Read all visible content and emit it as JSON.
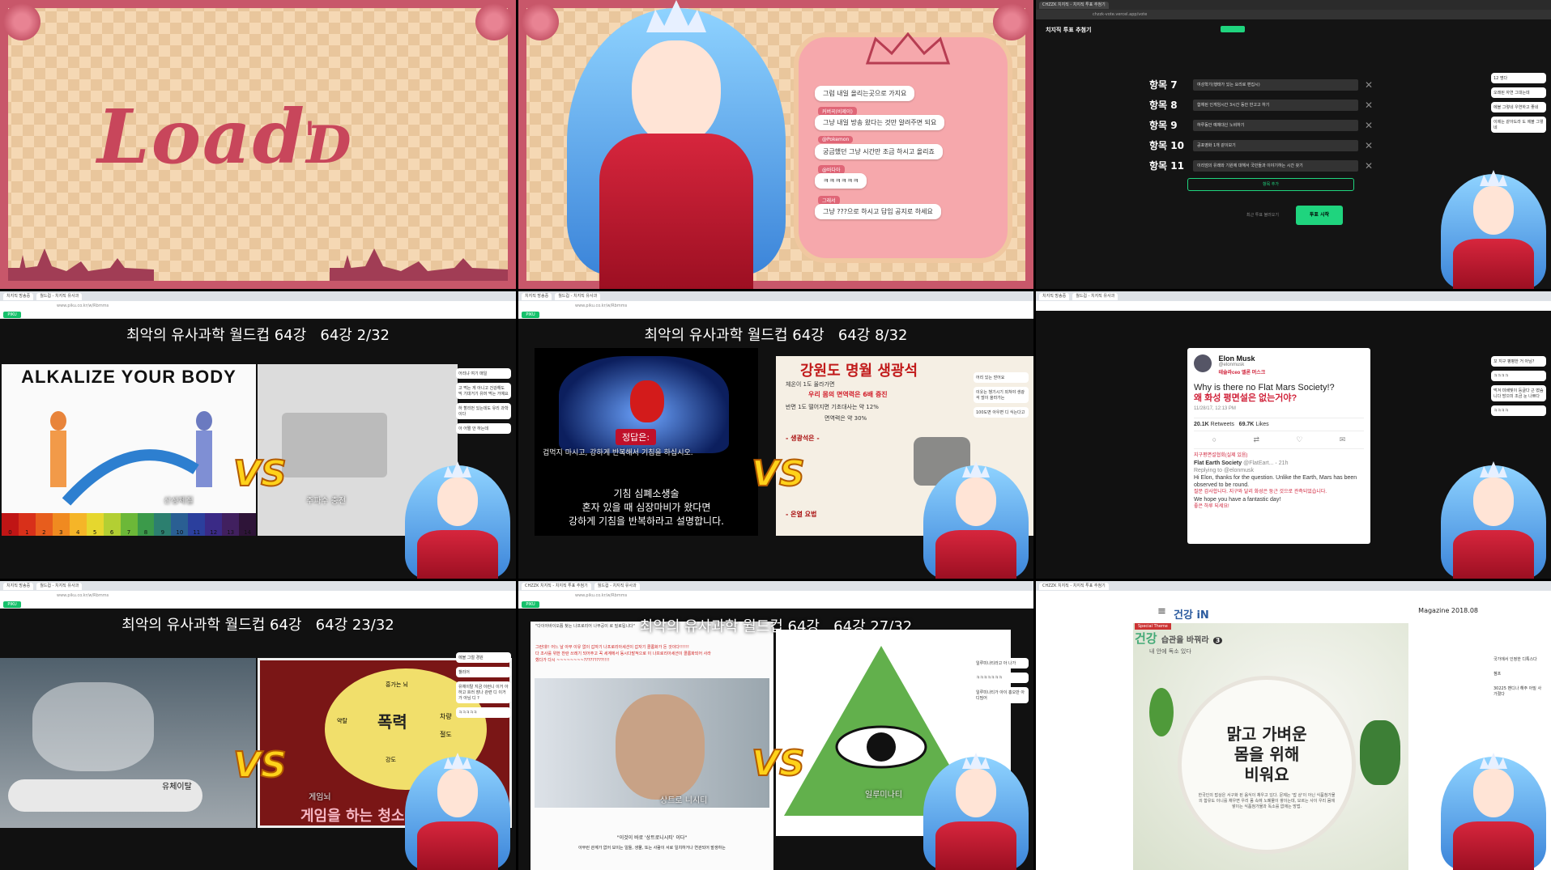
{
  "cell1": {
    "load_main": "Load",
    "load_d": "D",
    "load_cursor": "I"
  },
  "cell2": {
    "chat": [
      {
        "name": "",
        "text": "그럼 내일 올리는곳으로 가지요"
      },
      {
        "name": "커버곡(비제이)",
        "text": "그냥 내일 방송 왔다는 것만 알려주면 되요"
      },
      {
        "name": "@Pokemon",
        "text": "궁금했던 그냥 시간만 조금 하시고 올리죠"
      },
      {
        "name": "@바다아",
        "text": "ㅋㅋㅋㅋㅋㅋ"
      },
      {
        "name": "그래서",
        "text": "그냥 ???으로 하시고 답임 공지로 하세요"
      }
    ]
  },
  "cell3": {
    "tabs": [
      "CHZZK 치지직 - 치지직 투표 추첨기"
    ],
    "url": "chzzk-vote.vercel.app/vote",
    "header": "치지직 투표 추첨기",
    "items": [
      {
        "label": "항목 7",
        "value": "여성학기(행태가 있는 요리로 편집시)"
      },
      {
        "label": "항목 8",
        "value": "합체된 인게임시간 3시간 동안 반고고 하기"
      },
      {
        "label": "항목 9",
        "value": "하루동안 예체대신 노비하기"
      },
      {
        "label": "항목 10",
        "value": "공포영화 1개 같이보기"
      },
      {
        "label": "항목 11",
        "value": "이리엄의 유래와 기원에 대해서 국민들과 이야기하는 시간 갖기"
      }
    ],
    "add_button": "항목 추가",
    "start_button": "투표 시작",
    "hint": "최근 투표 불러오기",
    "side_chat": [
      "12 명다",
      "오래된 자연 그대는데",
      "에블 그렇네 우연하고 좋네",
      "이제는 같아도라 도 에블 그렇네"
    ]
  },
  "worldcup_title": "최악의 유사과학 월드컵 64강",
  "cell4": {
    "tabs": [
      "치지직 방송중",
      "월드컵 - 치지직 유사과"
    ],
    "url": "www.piku.co.kr/w/Rbmms",
    "round": "64강  2/32",
    "left_title": "ALKALIZE YOUR BODY",
    "ph": [
      "0",
      "1",
      "2",
      "3",
      "4",
      "5",
      "6",
      "7",
      "8",
      "9",
      "10",
      "11",
      "12",
      "13",
      "14"
    ],
    "left_caption": "산성체질",
    "right_caption": "주파수 충전",
    "vs": "VS",
    "side_chat": [
      "어리냐 여기 매일",
      "고 먹는 게 아니고 건강해도 믹 기대거기 유머 먹는 거예요",
      "하 할리먼 있는데도 유리 과학이다",
      "아 어쩔 안 하는데"
    ]
  },
  "cell5": {
    "round": "64강  8/32",
    "answer": "정답은:",
    "caption_top": "겁먹지 마시고, 강하게 반복해서 기침을 하십시오.",
    "subtitle_1": "기침 심폐소생술",
    "subtitle_2": "혼자 있을 때 심장마비가 왔다면",
    "subtitle_3": "강하게 기침을 반복하라고 설명합니다.",
    "right_title": "강원도 명월 생광석",
    "right_red": "우리 몸의 면역력은 6배 증진",
    "right_lines": [
      "체온이 1도 올라가면",
      "반면 1도 떨어지면 기초대사는 약 12%",
      "면역력은 약 30%",
      "- 생광석은 -",
      "- 온열 요법"
    ],
    "vs": "VS",
    "side_chat": [
      "어리 있는 얻어요",
      "이웃는 챙기시기 외쳐야 생광석 많이 올라가는",
      "100도면 아우면 디 식는다고"
    ]
  },
  "cell6": {
    "tw_name": "Elon Musk",
    "tw_handle": "@elonmusk",
    "tw_handle_kr": "테슬라ceo 엘론 머스크",
    "tw_body": "Why is there no Flat Mars Society!?",
    "tw_body_kr": "왜 화성 평면설은 없는거야?",
    "tw_date": "11/28/17, 12:13 PM",
    "tw_retweets": "20.1K",
    "tw_retweets_label": "Retweets",
    "tw_likes": "69.7K",
    "tw_likes_label": "Likes",
    "tw_red_kr": "지구평면설협회(실제 있음)",
    "reply_name": "Flat Earth Society",
    "reply_handle": "@FlatEart...",
    "reply_time": "21h",
    "reply_to": "Replying to @elonmusk",
    "reply_body": "Hi Elon, thanks for the question. Unlike the Earth, Mars has been observed to be round.",
    "reply_body_kr": "질문 감사합니다. 지구와 달리 화성은 둥근 것으로 관측되었습니다.",
    "reply_end": "We hope you have a fantastic day!",
    "reply_end_kr": "좋은 하루 되세요!",
    "side_chat": [
      "꼬 지구 평평한 거 아님?",
      "ㅋㅋㅋㅋ",
      "먹겨 미배빛이 둥글다 근 떴슴니다 방으미 조금 눈 나쁘다",
      "ㅋㅋㅋㅋ"
    ]
  },
  "cell7": {
    "round": "64강  23/32",
    "left_caption": "유체이탈",
    "right_caption": "게임뇌",
    "brain_center": "폭력",
    "brain_words": [
      "흥가는 뇌",
      "차량",
      "절도",
      "강도",
      "약탈"
    ],
    "brain_bottom": "게임을 하는 청소년",
    "vs": "VS",
    "side_chat": [
      "에블 그럴 경원",
      "챌리어",
      "유체이탈 지금 이런니 이거 아 하고 흐러 장나 관련 디 이거 가 아님 디 ?",
      "ㅋㅋㅋㅋㅋ"
    ]
  },
  "cell8": {
    "round": "64강  27/32",
    "intro": "\"다이아바이오쯤 찾는 나프로리어 나무공이 로 밀로됩니다\"",
    "red_line": "그런데!! 어느 날 아무 이유 없이 갑자기 나프로리아세션이 갑자기 콜롬화가 돈 것이다!!!!!!",
    "red_line_2": "다 조사를 위한 찬란 쓰레기 되어주고 꼭 세계에서 동시다발적으로 이 나프로리아세션이 콜롬화되어 사라",
    "red_line_3": "했다가 다시 ~~~~~~~~?????????!!!!",
    "left_caption": "상트로 니시티",
    "right_caption": "일루미나티",
    "bottom_1": "\"이것이 바로 '상트로니시티' 이다\"",
    "bottom_2": "아무런 관계가 없어 보이는 일들, 생물, 또는 사람이 서로 일치하거나 연관되어 발생하는",
    "vs": "VS",
    "side_chat": [
      "일루미나티라고 아 나가",
      "ㅋㅋㅋㅋㅋㅋㅋ",
      "일루미나티가 아이 홍오만 아디밈어"
    ]
  },
  "cell9": {
    "logo": "건강 iN",
    "date": "Magazine 2018.08",
    "tag": "Special Theme",
    "side_title": "건강",
    "side_sub": "습관을 바꿔라",
    "side_num": "3",
    "side_line": "내 안에 독소 있다",
    "headline_1": "맑고 가벼운",
    "headline_2": "몸을 위해",
    "headline_3": "비워요",
    "body": "한국인의 밥상은 서구화 된 음식이 채우고 있다. 문제는 '밥 상'이 아닌 식품첨가물의 함유도 이니를 채우면 우리 몸 속에 노폐물이 쌓이는데, 모르는 사이 우리 몸에 쌓이는 식품첨가물과 독소를 없애는 방법.",
    "side_chat": [
      "국가에서 인정한 디톡스다",
      "쳄프",
      "30225 밴디나 해주 아밀 사 가졌다"
    ]
  }
}
